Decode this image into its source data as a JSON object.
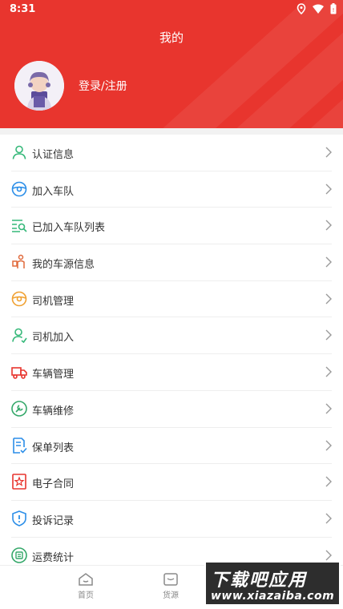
{
  "status_bar": {
    "time": "8:31"
  },
  "header": {
    "title": "我的",
    "login_label": "登录/注册"
  },
  "menu": [
    {
      "label": "认证信息",
      "icon": "person-icon",
      "color": "#35b879"
    },
    {
      "label": "加入车队",
      "icon": "steering-wheel-icon",
      "color": "#2b8ee8"
    },
    {
      "label": "已加入车队列表",
      "icon": "list-search-icon",
      "color": "#35b879"
    },
    {
      "label": "我的车源信息",
      "icon": "cargo-person-icon",
      "color": "#e06a3c"
    },
    {
      "label": "司机管理",
      "icon": "steering-wheel-icon",
      "color": "#f0a132"
    },
    {
      "label": "司机加入",
      "icon": "add-person-icon",
      "color": "#35b879"
    },
    {
      "label": "车辆管理",
      "icon": "truck-icon",
      "color": "#e8352e"
    },
    {
      "label": "车辆维修",
      "icon": "wrench-icon",
      "color": "#35a86a"
    },
    {
      "label": "保单列表",
      "icon": "document-check-icon",
      "color": "#2b8ee8"
    },
    {
      "label": "电子合同",
      "icon": "contract-icon",
      "color": "#e8352e"
    },
    {
      "label": "投诉记录",
      "icon": "shield-alert-icon",
      "color": "#2b8ee8"
    },
    {
      "label": "运费统计",
      "icon": "freight-stats-icon",
      "color": "#35a86a"
    }
  ],
  "bottom_nav": [
    {
      "label": "首页",
      "icon": "home-icon"
    },
    {
      "label": "货源",
      "icon": "cargo-icon"
    }
  ],
  "watermark": {
    "top": "下载吧应用",
    "bottom": "www.xiazaiba.com"
  },
  "colors": {
    "brand": "#e8352e",
    "chevron": "#9a9a9a"
  }
}
